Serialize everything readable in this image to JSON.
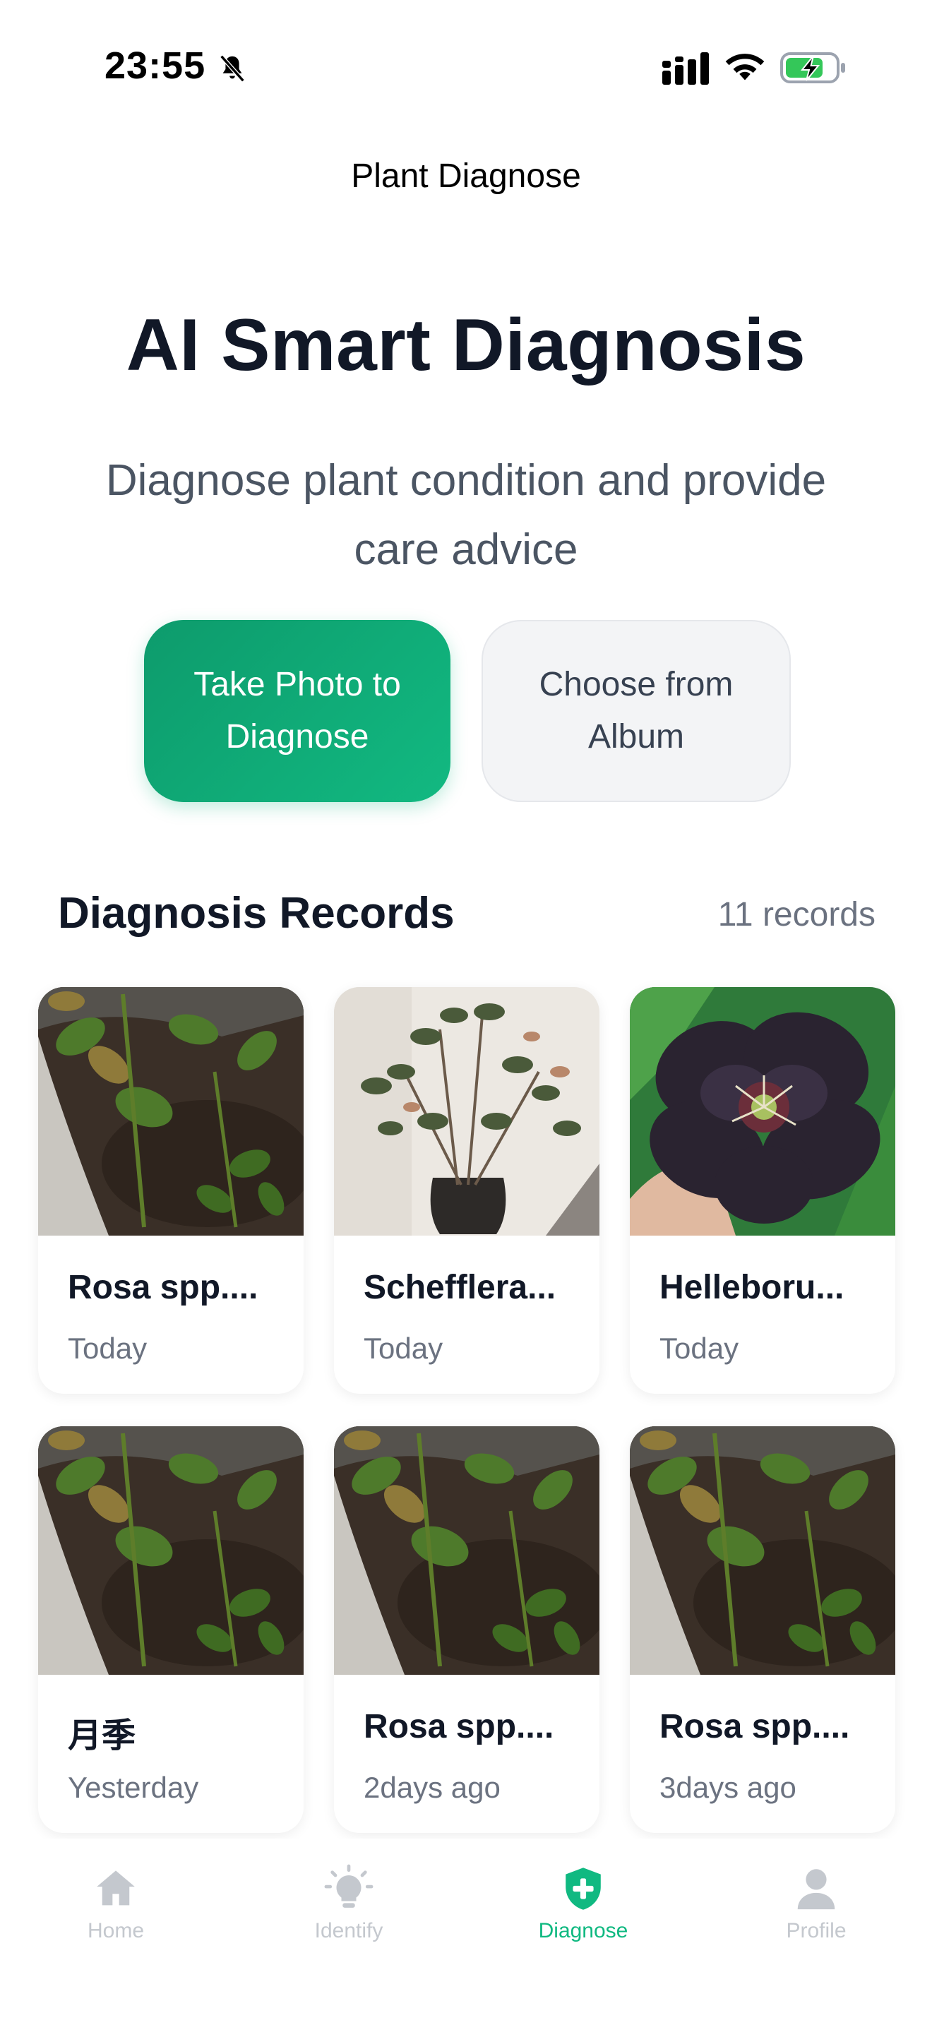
{
  "status_bar": {
    "time": "23:55",
    "icons": [
      "bell-off-icon",
      "signal-icon",
      "wifi-icon",
      "battery-charging-icon"
    ]
  },
  "nav": {
    "title": "Plant Diagnose"
  },
  "hero": {
    "title": "AI Smart Diagnosis",
    "subtitle": "Diagnose plant condition and provide care advice"
  },
  "actions": {
    "take_photo": "Take Photo to Diagnose",
    "choose_album": "Choose from Album"
  },
  "records": {
    "title": "Diagnosis Records",
    "count": "11 records",
    "items": [
      {
        "name": "Rosa spp....",
        "date": "Today",
        "photo": "rose-leaves"
      },
      {
        "name": "Schefflera...",
        "date": "Today",
        "photo": "schefflera"
      },
      {
        "name": "Helleboru...",
        "date": "Today",
        "photo": "hellebore-flower"
      },
      {
        "name": "月季",
        "date": "Yesterday",
        "photo": "rose-leaves"
      },
      {
        "name": "Rosa spp....",
        "date": "2days ago",
        "photo": "rose-leaves"
      },
      {
        "name": "Rosa spp....",
        "date": "3days ago",
        "photo": "rose-leaves"
      }
    ]
  },
  "tabs": [
    {
      "label": "Home",
      "icon": "home-icon",
      "active": false
    },
    {
      "label": "Identify",
      "icon": "lightbulb-icon",
      "active": false
    },
    {
      "label": "Diagnose",
      "icon": "shield-plus-icon",
      "active": true
    },
    {
      "label": "Profile",
      "icon": "person-icon",
      "active": false
    }
  ],
  "colors": {
    "accent": "#10b981",
    "accent_dark": "#0d9b6c",
    "title": "#111827",
    "muted": "#6b7280",
    "tab_inactive": "#c4c8ce"
  }
}
